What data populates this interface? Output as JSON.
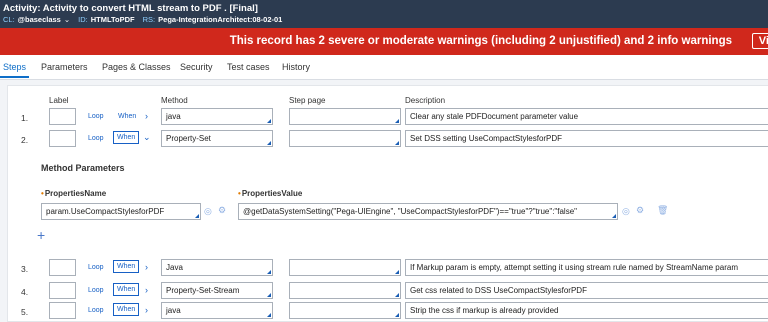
{
  "header": {
    "title": "Activity: Activity to convert HTML stream to PDF . [Final]",
    "cl_key": "CL:",
    "cl_value": "@baseclass",
    "id_key": "ID:",
    "id_value": "HTMLToPDF",
    "rs_key": "RS:",
    "rs_value": "Pega-IntegrationArchitect:08-02-01"
  },
  "warning": {
    "text": "This record has 2 severe or moderate warnings (including 2 unjustified) and 2 info warnings",
    "button": "Vi"
  },
  "tabs": [
    "Steps",
    "Parameters",
    "Pages & Classes",
    "Security",
    "Test cases",
    "History"
  ],
  "active_tab": "Steps",
  "columns": {
    "label": "Label",
    "method": "Method",
    "step_page": "Step page",
    "description": "Description"
  },
  "rows": [
    {
      "num": "1.",
      "loop": "Loop",
      "when": "When",
      "expand": "›",
      "method": "java",
      "step_page": "",
      "description": "Clear any stale PDFDocument parameter value"
    },
    {
      "num": "2.",
      "loop": "Loop",
      "when": "When",
      "expand": "⌄",
      "method": "Property-Set",
      "step_page": "",
      "description": "Set DSS setting UseCompactStylesforPDF"
    },
    {
      "num": "3.",
      "loop": "Loop",
      "when": "When",
      "expand": "›",
      "method": "Java",
      "step_page": "",
      "description": "If Markup param is empty, attempt setting it using stream rule named by StreamName param"
    },
    {
      "num": "4.",
      "loop": "Loop",
      "when": "When",
      "expand": "›",
      "method": "Property-Set-Stream",
      "step_page": "",
      "description": "Get css related to DSS UseCompactStylesforPDF"
    },
    {
      "num": "5.",
      "loop": "Loop",
      "when": "When",
      "expand": "›",
      "method": "java",
      "step_page": "",
      "description": "Strip the css if markup is already provided"
    }
  ],
  "method_params": {
    "title": "Method Parameters",
    "name_label": "PropertiesName",
    "value_label": "PropertiesValue",
    "name_value": "param.UseCompactStylesforPDF",
    "value_value": "@getDataSystemSetting(\"Pega-UIEngine\", \"UseCompactStylesforPDF\")==\"true\"?\"true\":\"false\"",
    "add_glyph": "+"
  }
}
